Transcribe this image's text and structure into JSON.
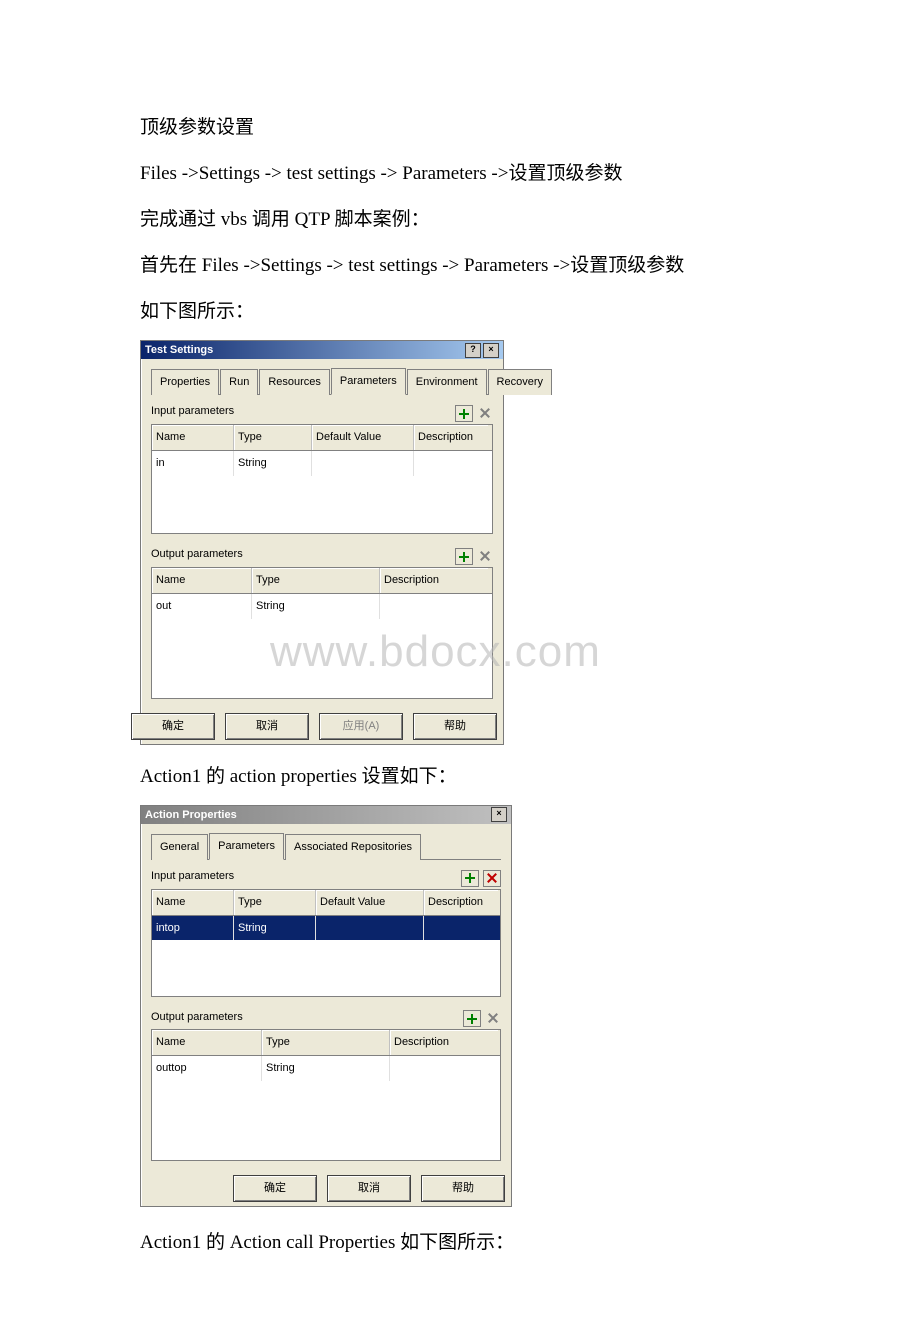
{
  "doc": {
    "p1": "顶级参数设置",
    "p2": "Files ->Settings -> test settings -> Parameters ->设置顶级参数",
    "p3": "完成通过 vbs 调用 QTP 脚本案例：",
    "p4": "首先在 Files ->Settings -> test settings -> Parameters ->设置顶级参数",
    "p5": "如下图所示：",
    "p6": "Action1 的 action properties 设置如下：",
    "p7": "Action1 的 Action call Properties 如下图所示：",
    "watermark": "www.bdocx.com"
  },
  "dialog1": {
    "title": "Test Settings",
    "tabs": [
      "Properties",
      "Run",
      "Resources",
      "Parameters",
      "Environment",
      "Recovery"
    ],
    "input_label": "Input parameters",
    "output_label": "Output parameters",
    "input_headers": [
      "Name",
      "Type",
      "Default Value",
      "Description"
    ],
    "output_headers": [
      "Name",
      "Type",
      "Description"
    ],
    "input_rows": [
      {
        "name": "in",
        "type": "String",
        "default": "",
        "desc": ""
      }
    ],
    "output_rows": [
      {
        "name": "out",
        "type": "String",
        "desc": ""
      }
    ],
    "buttons": {
      "ok": "确定",
      "cancel": "取消",
      "apply": "应用(A)",
      "help": "帮助"
    }
  },
  "dialog2": {
    "title": "Action Properties",
    "tabs": [
      "General",
      "Parameters",
      "Associated Repositories"
    ],
    "input_label": "Input parameters",
    "output_label": "Output parameters",
    "input_headers": [
      "Name",
      "Type",
      "Default Value",
      "Description"
    ],
    "output_headers": [
      "Name",
      "Type",
      "Description"
    ],
    "input_rows": [
      {
        "name": "intop",
        "type": "String",
        "default": "",
        "desc": ""
      }
    ],
    "output_rows": [
      {
        "name": "outtop",
        "type": "String",
        "desc": ""
      }
    ],
    "buttons": {
      "ok": "确定",
      "cancel": "取消",
      "help": "帮助"
    }
  }
}
